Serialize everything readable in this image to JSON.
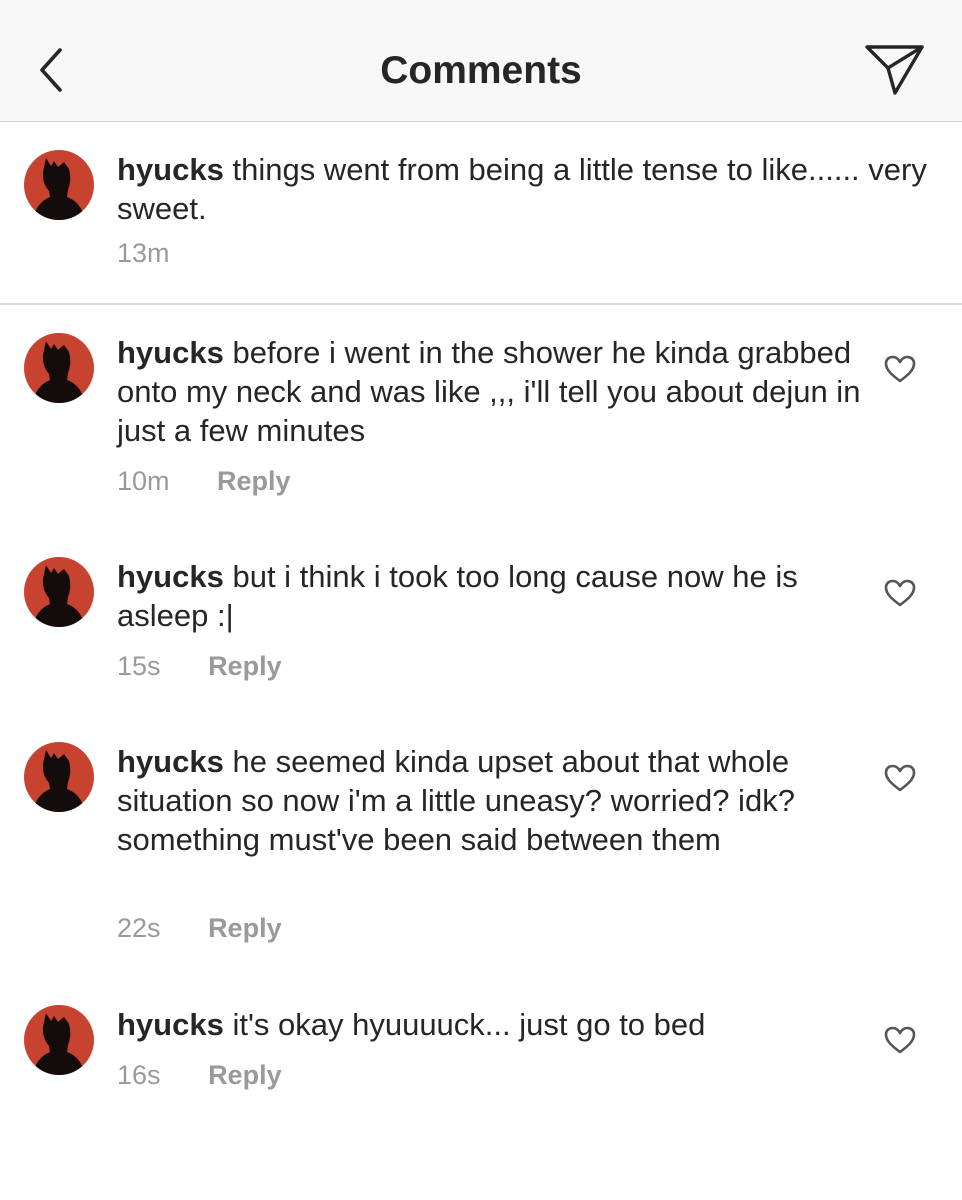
{
  "header": {
    "title": "Comments"
  },
  "icons": {
    "back": "chevron-left-icon",
    "send": "paper-plane-icon",
    "like": "heart-outline-icon"
  },
  "colors": {
    "avatar_bg": "#c8432f",
    "text": "#262626",
    "meta": "#9a9a9a"
  },
  "caption": {
    "username": "hyucks",
    "text": "things went from being a little tense to like...... very sweet.",
    "time": "13m"
  },
  "comments": [
    {
      "username": "hyucks",
      "text": "before i went in the shower he kinda grabbed onto my neck and was like ,,, i'll tell you about dejun in just a few minutes",
      "time": "10m",
      "reply_label": "Reply"
    },
    {
      "username": "hyucks",
      "text": "but i think i took too long cause now he is asleep :|",
      "time": "15s",
      "reply_label": "Reply"
    },
    {
      "username": "hyucks",
      "text": "he seemed kinda upset about that whole situation so now i'm a little uneasy? worried? idk? something must've been said between them",
      "time": "22s",
      "reply_label": "Reply"
    },
    {
      "username": "hyucks",
      "text": "it's okay hyuuuuck... just go to bed",
      "time": "16s",
      "reply_label": "Reply"
    }
  ]
}
